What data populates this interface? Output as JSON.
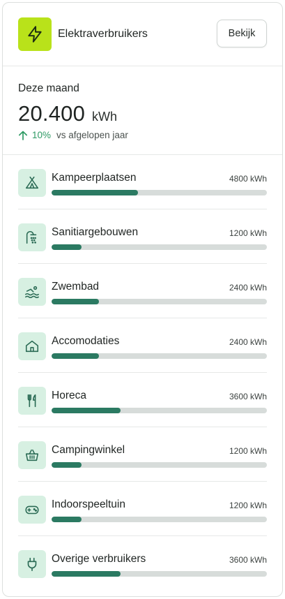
{
  "header": {
    "title": "Elektraverbruikers",
    "view_label": "Bekijk",
    "icon": "lightning-icon",
    "icon_bg": "#b9e21a"
  },
  "summary": {
    "period_label": "Deze maand",
    "total_value": "20.400",
    "total_unit": "kWh",
    "trend_percent": "10%",
    "trend_text": "vs afgelopen jaar",
    "trend_direction": "up",
    "trend_color": "#2e9a64"
  },
  "consumers": [
    {
      "name": "Kampeerplaatsen",
      "value": "4800 kWh",
      "icon": "tent-icon",
      "fill": 0.4
    },
    {
      "name": "Sanitiargebouwen",
      "value": "1200 kWh",
      "icon": "shower-icon",
      "fill": 0.14
    },
    {
      "name": "Zwembad",
      "value": "2400 kWh",
      "icon": "swimming-icon",
      "fill": 0.22
    },
    {
      "name": "Accomodaties",
      "value": "2400 kWh",
      "icon": "house-icon",
      "fill": 0.22
    },
    {
      "name": "Horeca",
      "value": "3600 kWh",
      "icon": "cutlery-icon",
      "fill": 0.32
    },
    {
      "name": "Campingwinkel",
      "value": "1200 kWh",
      "icon": "basket-icon",
      "fill": 0.14
    },
    {
      "name": "Indoorspeeltuin",
      "value": "1200 kWh",
      "icon": "gamepad-icon",
      "fill": 0.14
    },
    {
      "name": "Overige verbruikers",
      "value": "3600 kWh",
      "icon": "plug-icon",
      "fill": 0.32
    }
  ],
  "colors": {
    "accent": "#2b7a62",
    "icon_tile": "#d7f0e2",
    "track": "#d7dcda"
  }
}
